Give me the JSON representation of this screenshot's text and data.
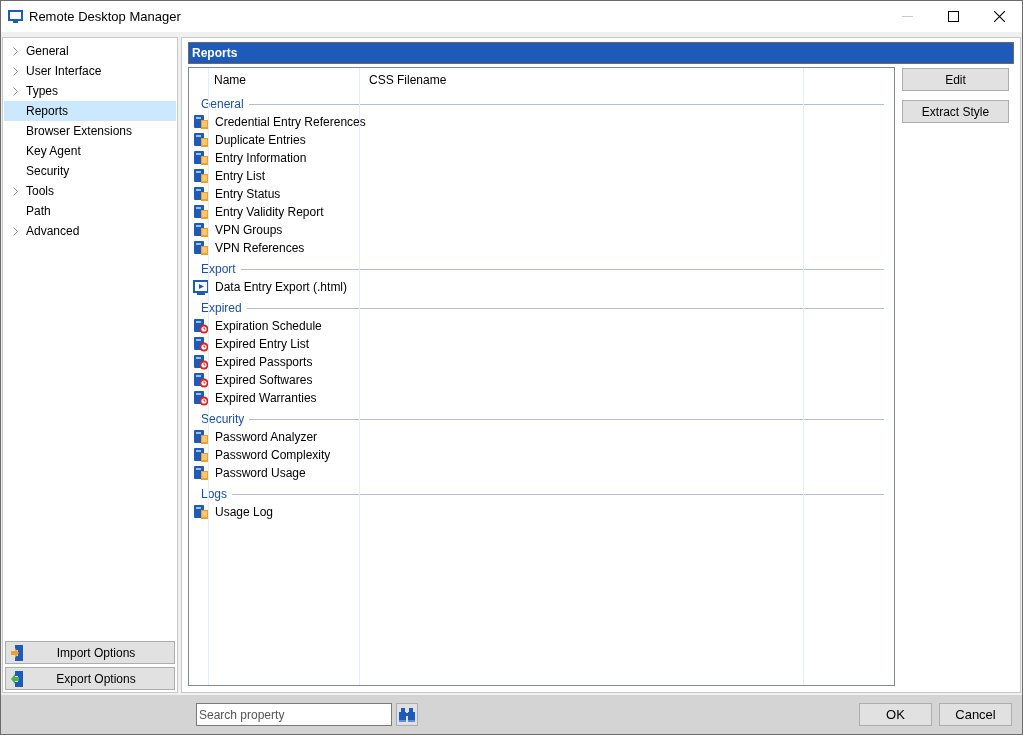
{
  "window": {
    "title": "Remote Desktop Manager"
  },
  "sidebar": {
    "items": [
      {
        "label": "General",
        "expandable": true,
        "selected": false
      },
      {
        "label": "User Interface",
        "expandable": true,
        "selected": false
      },
      {
        "label": "Types",
        "expandable": true,
        "selected": false
      },
      {
        "label": "Reports",
        "expandable": false,
        "selected": true
      },
      {
        "label": "Browser Extensions",
        "expandable": false,
        "selected": false
      },
      {
        "label": "Key Agent",
        "expandable": false,
        "selected": false
      },
      {
        "label": "Security",
        "expandable": false,
        "selected": false
      },
      {
        "label": "Tools",
        "expandable": true,
        "selected": false
      },
      {
        "label": "Path",
        "expandable": false,
        "selected": false
      },
      {
        "label": "Advanced",
        "expandable": true,
        "selected": false
      }
    ],
    "buttons": [
      "Import Options",
      "Export Options"
    ]
  },
  "panel": {
    "title": "Reports",
    "columns": [
      "Name",
      "CSS Filename"
    ],
    "groups": [
      {
        "name": "General",
        "kind": "doc",
        "items": [
          "Credential Entry References",
          "Duplicate Entries",
          "Entry Information",
          "Entry List",
          "Entry Status",
          "Entry Validity Report",
          "VPN Groups",
          "VPN References"
        ]
      },
      {
        "name": "Export",
        "kind": "screen",
        "items": [
          "Data Entry Export (.html)"
        ]
      },
      {
        "name": "Expired",
        "kind": "clock",
        "items": [
          "Expiration Schedule",
          "Expired Entry List",
          "Expired Passports",
          "Expired Softwares",
          "Expired Warranties"
        ]
      },
      {
        "name": "Security",
        "kind": "doc",
        "items": [
          "Password Analyzer",
          "Password Complexity",
          "Password Usage"
        ]
      },
      {
        "name": "Logs",
        "kind": "doc",
        "items": [
          "Usage Log"
        ]
      }
    ],
    "actions": [
      "Edit",
      "Extract Style"
    ]
  },
  "footer": {
    "search": {
      "placeholder": "Search property"
    },
    "buttons": [
      "OK",
      "Cancel"
    ]
  }
}
